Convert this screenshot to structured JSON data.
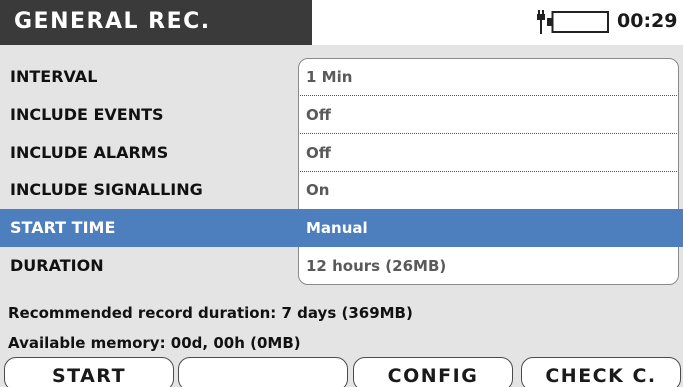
{
  "header": {
    "title": "GENERAL REC.",
    "clock": "00:29",
    "status_icons": [
      "plug-icon",
      "battery-icon"
    ]
  },
  "settings": {
    "rows": [
      {
        "label": "INTERVAL",
        "value": "1 Min",
        "selected": false
      },
      {
        "label": "INCLUDE EVENTS",
        "value": "Off",
        "selected": false
      },
      {
        "label": "INCLUDE ALARMS",
        "value": "Off",
        "selected": false
      },
      {
        "label": "INCLUDE SIGNALLING",
        "value": "On",
        "selected": false
      },
      {
        "label": "START TIME",
        "value": "Manual",
        "selected": true
      },
      {
        "label": "DURATION",
        "value": "12 hours  (26MB)",
        "selected": false
      }
    ]
  },
  "info": {
    "recommended": "Recommended record duration:  7 days  (369MB)",
    "available": "Available memory: 00d, 00h (0MB)"
  },
  "function_keys": {
    "f1": "START",
    "f2": "",
    "f3": "CONFIG",
    "f4": "CHECK C."
  },
  "colors": {
    "header_background": "#3a3a3a",
    "selection": "#4d7ebd",
    "screen_background": "#e4e4e4"
  }
}
